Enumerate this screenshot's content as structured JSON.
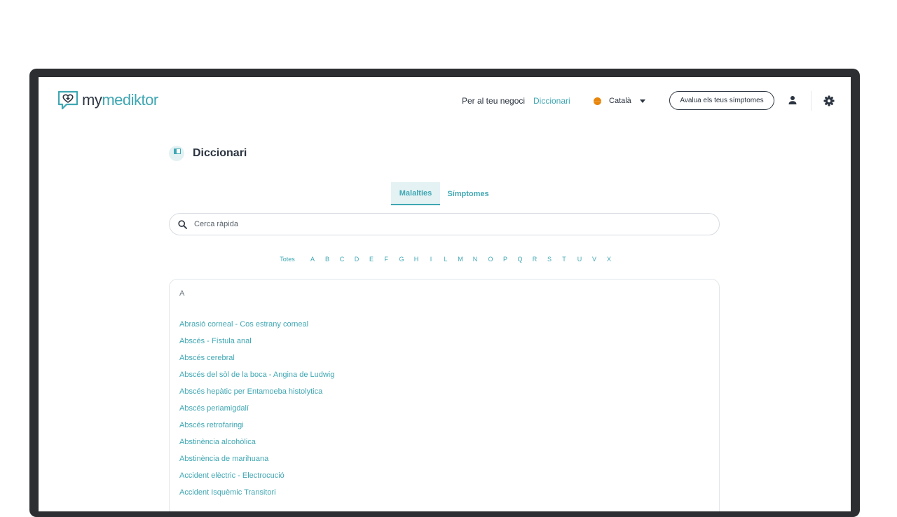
{
  "brand": {
    "logo_my": "my",
    "logo_mediktor": "mediktor"
  },
  "nav": {
    "business": "Per al teu negoci",
    "dictionary": "Diccionari",
    "language": "Català",
    "evaluate_button": "Avalua els teus símptomes"
  },
  "page": {
    "title": "Diccionari"
  },
  "tabs": [
    {
      "label": "Malalties",
      "active": true
    },
    {
      "label": "Símptomes",
      "active": false
    }
  ],
  "search": {
    "placeholder": "Cerca ràpida"
  },
  "letters": [
    "Totes",
    "A",
    "B",
    "C",
    "D",
    "E",
    "F",
    "G",
    "H",
    "I",
    "L",
    "M",
    "N",
    "O",
    "P",
    "Q",
    "R",
    "S",
    "T",
    "U",
    "V",
    "X"
  ],
  "list": {
    "section_letter": "A",
    "entries": [
      "Abrasió corneal - Cos estrany corneal",
      "Abscés - Fístula anal",
      "Abscés cerebral",
      "Abscés del sòl de la boca - Angina de Ludwig",
      "Abscés hepàtic per Entamoeba histolytica",
      "Abscés periamigdalí",
      "Abscés retrofaringi",
      "Abstinència alcohòlica",
      "Abstinència de marihuana",
      "Accident elèctric - Electrocució",
      "Accident Isquèmic Transitori"
    ]
  },
  "colors": {
    "accent": "#3fa7b3",
    "text": "#2b3440",
    "device_frame": "#2c2e31",
    "flag": "#e8860c"
  },
  "icons": {
    "logo": "heart-chat-icon",
    "language": "flag-icon",
    "account": "user-icon",
    "settings": "gear-icon",
    "search": "search-icon",
    "dictionary": "book-icon"
  }
}
